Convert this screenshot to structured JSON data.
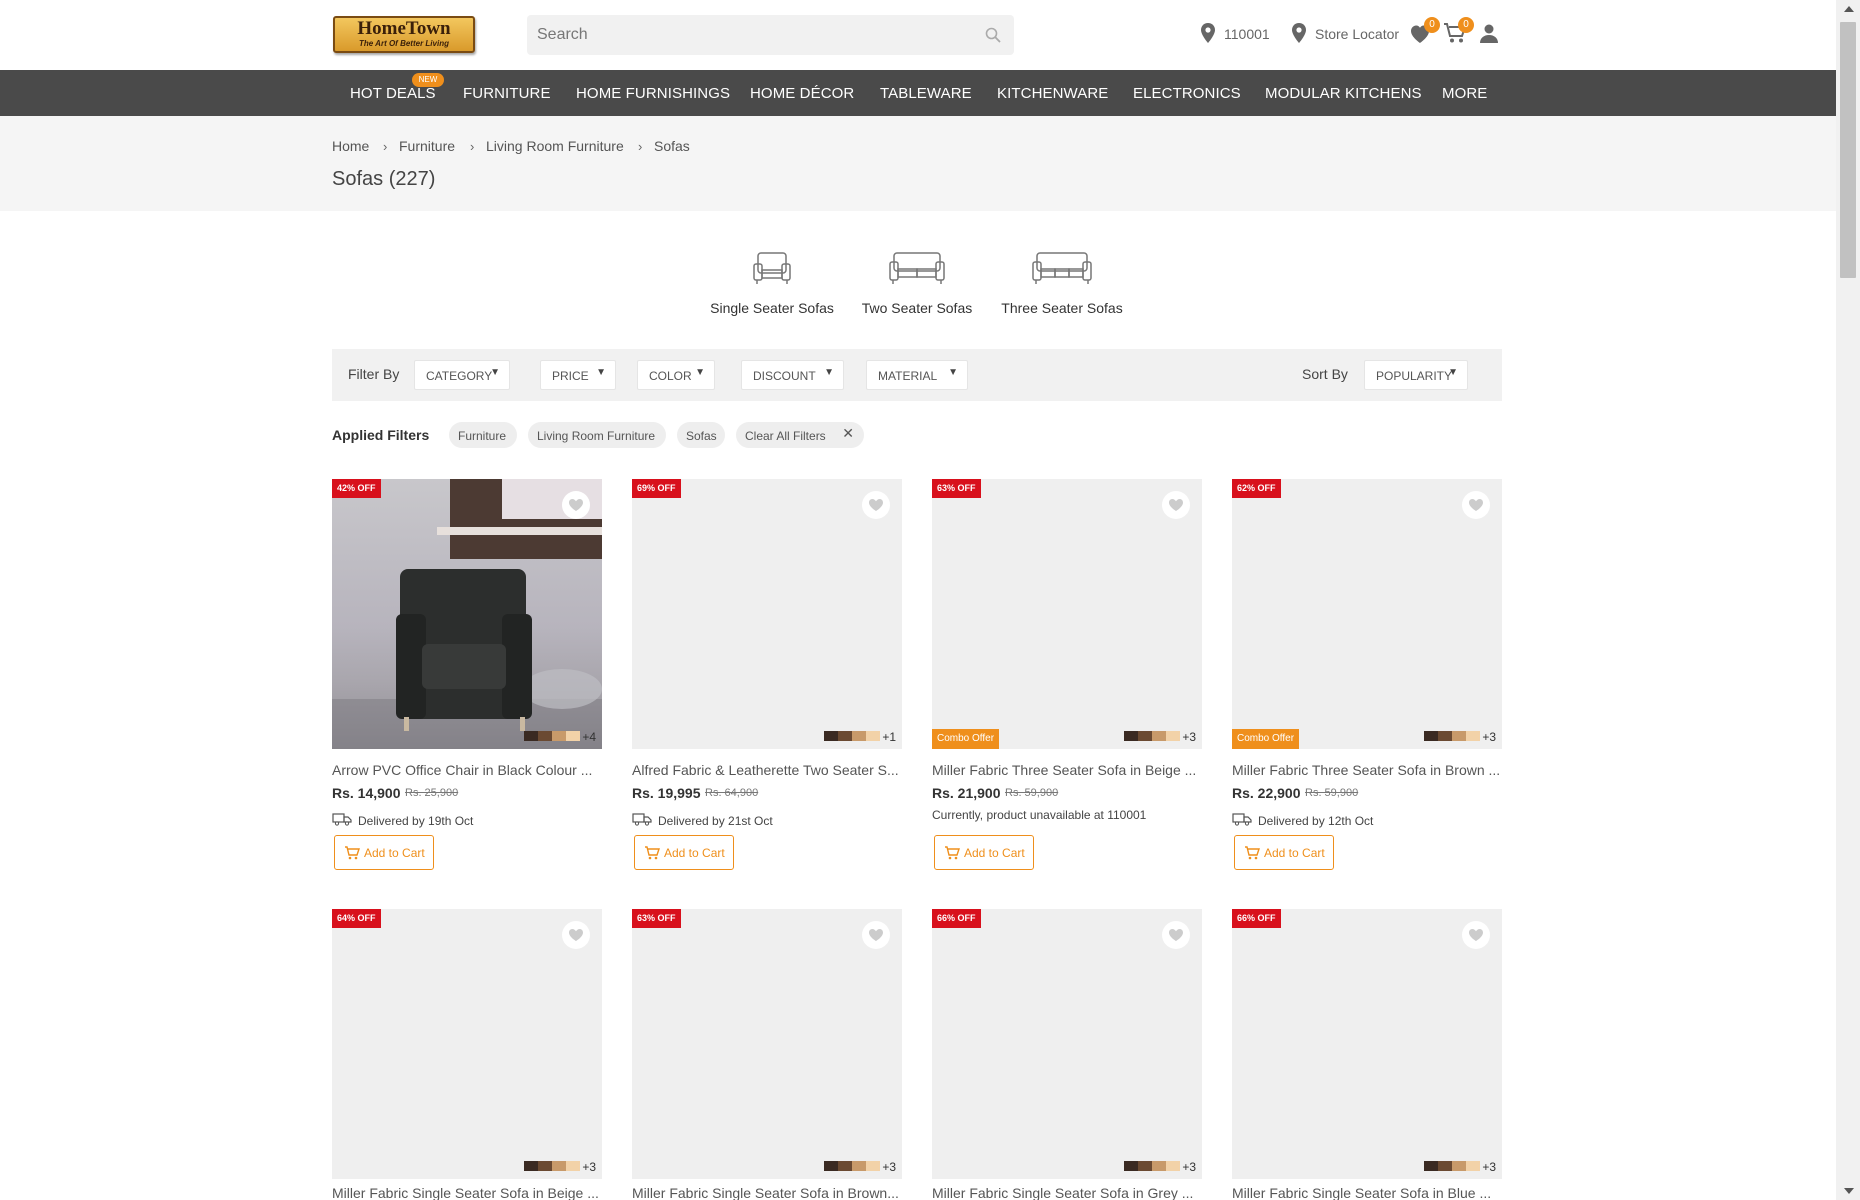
{
  "brand": {
    "name": "HomeTown",
    "tagline": "The Art Of Better Living"
  },
  "search": {
    "placeholder": "Search"
  },
  "header": {
    "pincode": "110001",
    "store_locator": "Store Locator",
    "wishlist_count": "0",
    "cart_count": "0"
  },
  "nav": {
    "items": [
      "HOT DEALS",
      "FURNITURE",
      "HOME FURNISHINGS",
      "HOME DÉCOR",
      "TABLEWARE",
      "KITCHENWARE",
      "ELECTRONICS",
      "MODULAR KITCHENS",
      "MORE"
    ],
    "new_badge": "NEW"
  },
  "breadcrumb": [
    "Home",
    "Furniture",
    "Living Room Furniture",
    "Sofas"
  ],
  "page_title": "Sofas (227)",
  "sofa_types": [
    "Single Seater Sofas",
    "Two Seater Sofas",
    "Three Seater Sofas"
  ],
  "filters": {
    "label": "Filter By",
    "options": [
      "CATEGORY",
      "PRICE",
      "COLOR",
      "DISCOUNT",
      "MATERIAL"
    ],
    "sort_label": "Sort By",
    "sort_value": "POPULARITY"
  },
  "applied_filters": {
    "label": "Applied Filters",
    "chips": [
      "Furniture",
      "Living Room Furniture",
      "Sofas"
    ],
    "clear_all": "Clear All Filters"
  },
  "colors": {
    "accent": "#ef8f1c",
    "nav_bg": "#4a4a4a",
    "discount_badge": "#d8101c"
  },
  "products": [
    {
      "discount": "42% OFF",
      "name": "Arrow PVC Office Chair in Black Colour ...",
      "price": "Rs. 14,900",
      "mrp": "Rs. 25,900",
      "delivery": "Delivered by 19th Oct",
      "more_colors": "+4",
      "add_to_cart": "Add to Cart"
    },
    {
      "discount": "69% OFF",
      "name": "Alfred Fabric & Leatherette Two Seater S...",
      "price": "Rs. 19,995",
      "mrp": "Rs. 64,900",
      "delivery": "Delivered by 21st Oct",
      "more_colors": "+1",
      "add_to_cart": "Add to Cart"
    },
    {
      "discount": "63% OFF",
      "name": "Miller Fabric Three Seater Sofa in Beige ...",
      "price": "Rs. 21,900",
      "mrp": "Rs. 59,900",
      "unavailable": "Currently, product unavailable at 110001",
      "combo": "Combo Offer",
      "more_colors": "+3",
      "add_to_cart": "Add to Cart"
    },
    {
      "discount": "62% OFF",
      "name": "Miller Fabric Three Seater Sofa in Brown ...",
      "price": "Rs. 22,900",
      "mrp": "Rs. 59,900",
      "delivery": "Delivered by 12th Oct",
      "combo": "Combo Offer",
      "more_colors": "+3",
      "add_to_cart": "Add to Cart"
    },
    {
      "discount": "64% OFF",
      "name": "Miller Fabric Single Seater Sofa in Beige ...",
      "more_colors": "+3"
    },
    {
      "discount": "63% OFF",
      "name": "Miller Fabric Single Seater Sofa in Brown...",
      "more_colors": "+3"
    },
    {
      "discount": "66% OFF",
      "name": "Miller Fabric Single Seater Sofa in Grey ...",
      "more_colors": "+3"
    },
    {
      "discount": "66% OFF",
      "name": "Miller Fabric Single Seater Sofa in Blue ...",
      "more_colors": "+3"
    }
  ]
}
